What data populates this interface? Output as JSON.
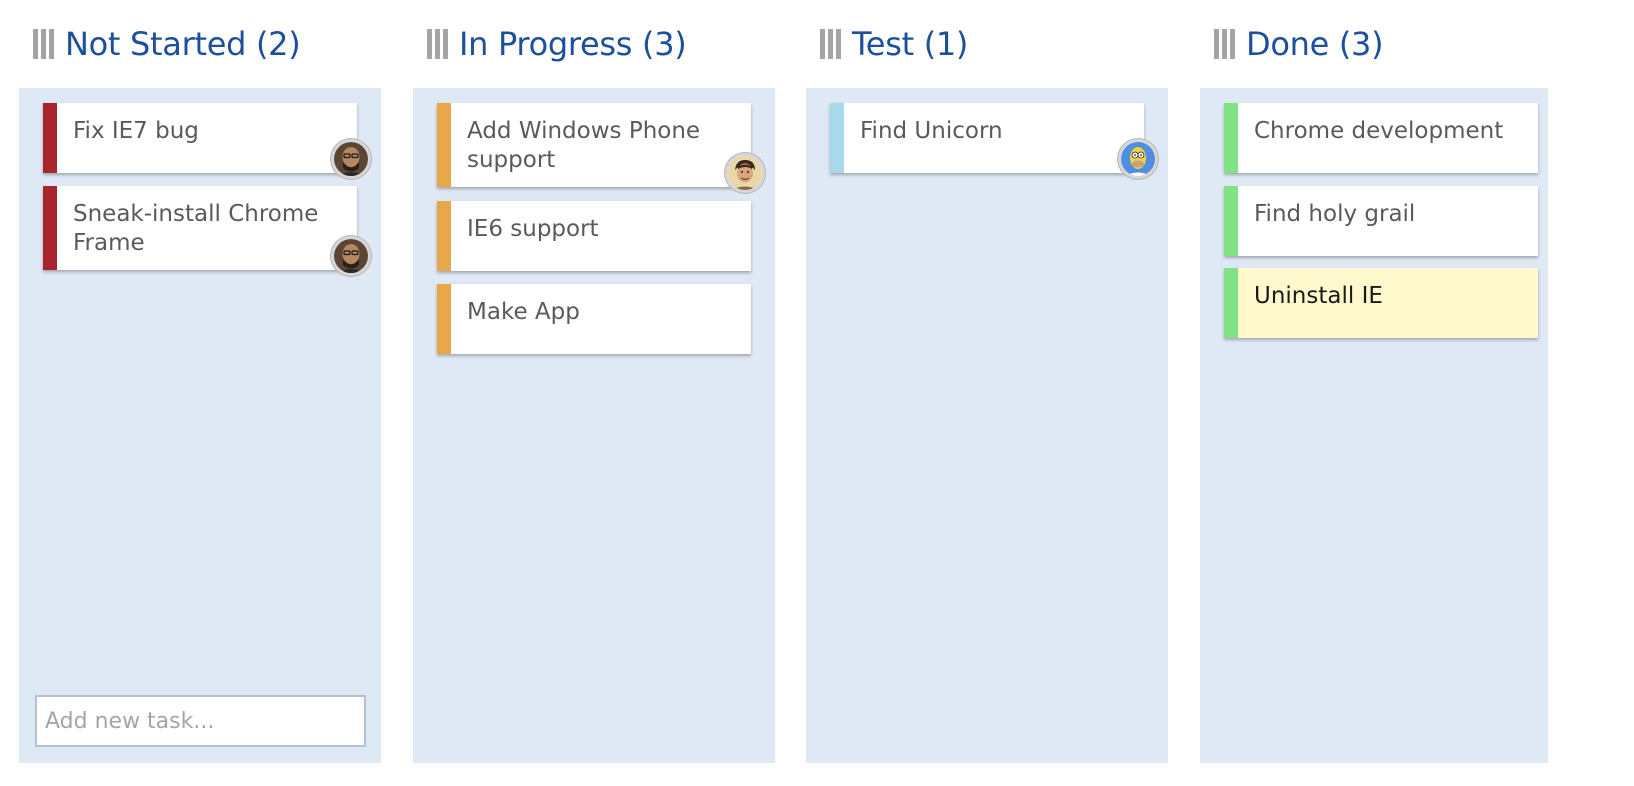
{
  "colors": {
    "header": "#1c4f9c",
    "column_bg": "#dfe8f5",
    "not_started": "#a9252b",
    "in_progress": "#e8a84a",
    "test": "#a8d9ea",
    "done": "#82e386",
    "highlight": "#fff9cd"
  },
  "columns": [
    {
      "title": "Not Started (2)",
      "cards": [
        {
          "title": "Fix IE7 bug",
          "avatar": "bald-man-avatar-icon"
        },
        {
          "title": "Sneak-install Chrome Frame",
          "avatar": "bald-man-avatar-icon"
        }
      ],
      "add_task_placeholder": "Add new task..."
    },
    {
      "title": "In Progress (3)",
      "cards": [
        {
          "title": "Add Windows Phone support",
          "avatar": "young-man-avatar-icon"
        },
        {
          "title": "IE6 support"
        },
        {
          "title": "Make App"
        }
      ]
    },
    {
      "title": "Test (1)",
      "cards": [
        {
          "title": "Find Unicorn",
          "avatar": "cartoon-avatar-icon"
        }
      ]
    },
    {
      "title": "Done (3)",
      "cards": [
        {
          "title": "Chrome development"
        },
        {
          "title": "Find holy grail"
        },
        {
          "title": "Uninstall IE"
        }
      ]
    }
  ]
}
